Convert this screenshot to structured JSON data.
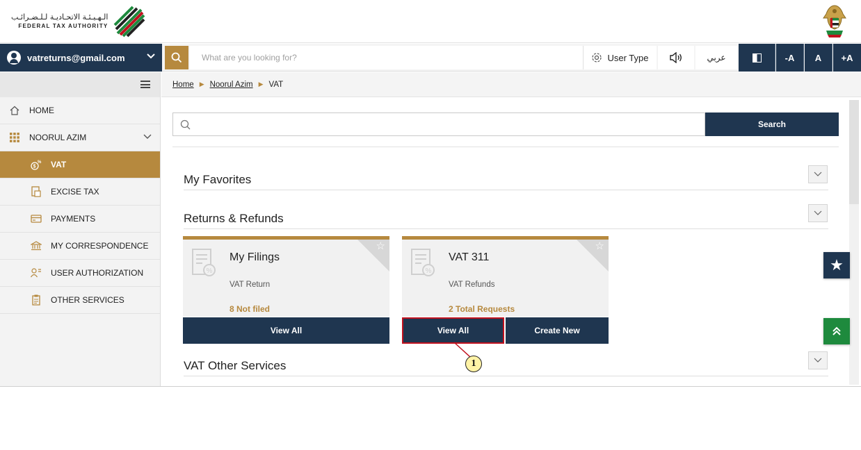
{
  "header": {
    "logo_arabic": "الـهـيـئـة الاتحـاديـة لـلـضـرائـب",
    "logo_english": "FEDERAL TAX AUTHORITY",
    "emblem_icon": "uae-emblem-icon"
  },
  "toolbar": {
    "user_email": "vatreturns@gmail.com",
    "search_placeholder": "What are you looking for?",
    "user_type_label": "User Type",
    "arabic_label": "عربي",
    "font_decrease": "-A",
    "font_normal": "A",
    "font_increase": "+A"
  },
  "sidebar": {
    "items": [
      {
        "label": "HOME",
        "icon": "home-icon"
      },
      {
        "label": "NOORUL AZIM",
        "icon": "grid-icon"
      },
      {
        "label": "VAT",
        "icon": "vat-icon",
        "active": true
      },
      {
        "label": "EXCISE TAX",
        "icon": "excise-icon"
      },
      {
        "label": "PAYMENTS",
        "icon": "payments-icon"
      },
      {
        "label": "MY CORRESPONDENCE",
        "icon": "bank-icon"
      },
      {
        "label": "USER AUTHORIZATION",
        "icon": "user-auth-icon"
      },
      {
        "label": "OTHER SERVICES",
        "icon": "document-icon"
      }
    ]
  },
  "breadcrumb": {
    "items": [
      "Home",
      "Noorul Azim",
      "VAT"
    ]
  },
  "main": {
    "search_button": "Search",
    "sections": [
      "My Favorites",
      "Returns & Refunds",
      "VAT Other Services"
    ],
    "cards": [
      {
        "title": "My Filings",
        "subtitle": "VAT Return",
        "count": "8 Not filed",
        "buttons": [
          "View All"
        ]
      },
      {
        "title": "VAT 311",
        "subtitle": "VAT Refunds",
        "count": "2 Total Requests",
        "buttons": [
          "View All",
          "Create New"
        ]
      }
    ],
    "callout_number": "1"
  },
  "colors": {
    "navy": "#1f3650",
    "gold": "#b6893e",
    "green": "#1e8a3d",
    "highlight": "#c1121f"
  }
}
